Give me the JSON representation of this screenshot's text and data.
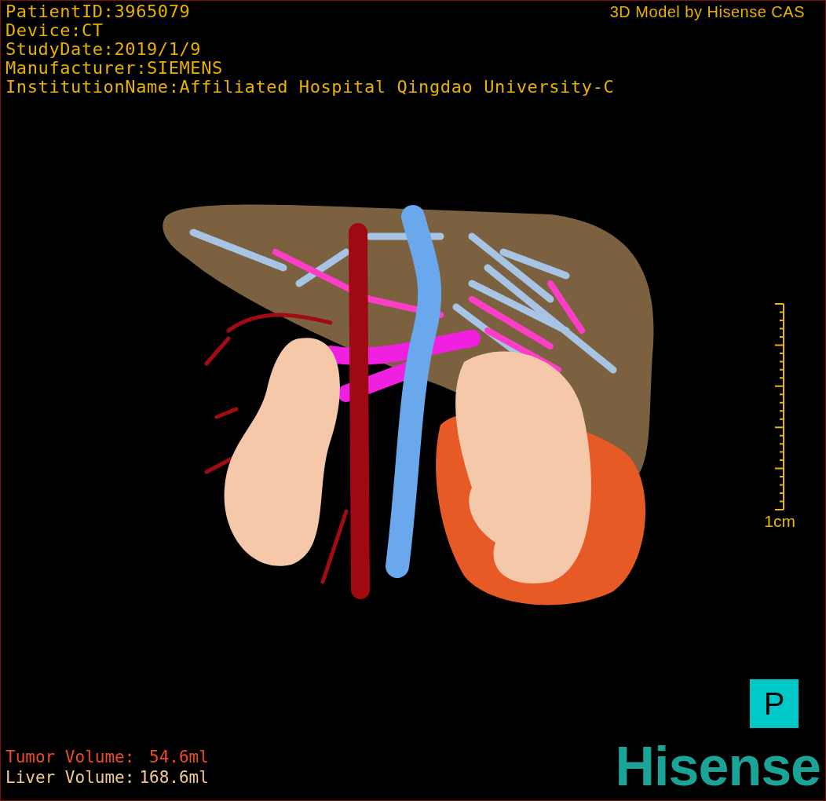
{
  "study_info": [
    "PatientID:3965079",
    "Device:CT",
    "StudyDate:2019/1/9",
    "Manufacturer:SIEMENS",
    "InstitutionName:Affiliated Hospital Qingdao University-C"
  ],
  "title": "3D Model by Hisense CAS",
  "scale_bar": {
    "label": "1cm"
  },
  "orientation_button": {
    "label": "P"
  },
  "volumes": [
    {
      "kind": "tumor",
      "label": "Tumor Volume:",
      "value": "54.6ml"
    },
    {
      "kind": "liver",
      "label": "Liver Volume:",
      "value": "168.6ml"
    }
  ],
  "logo": "Hisense"
}
